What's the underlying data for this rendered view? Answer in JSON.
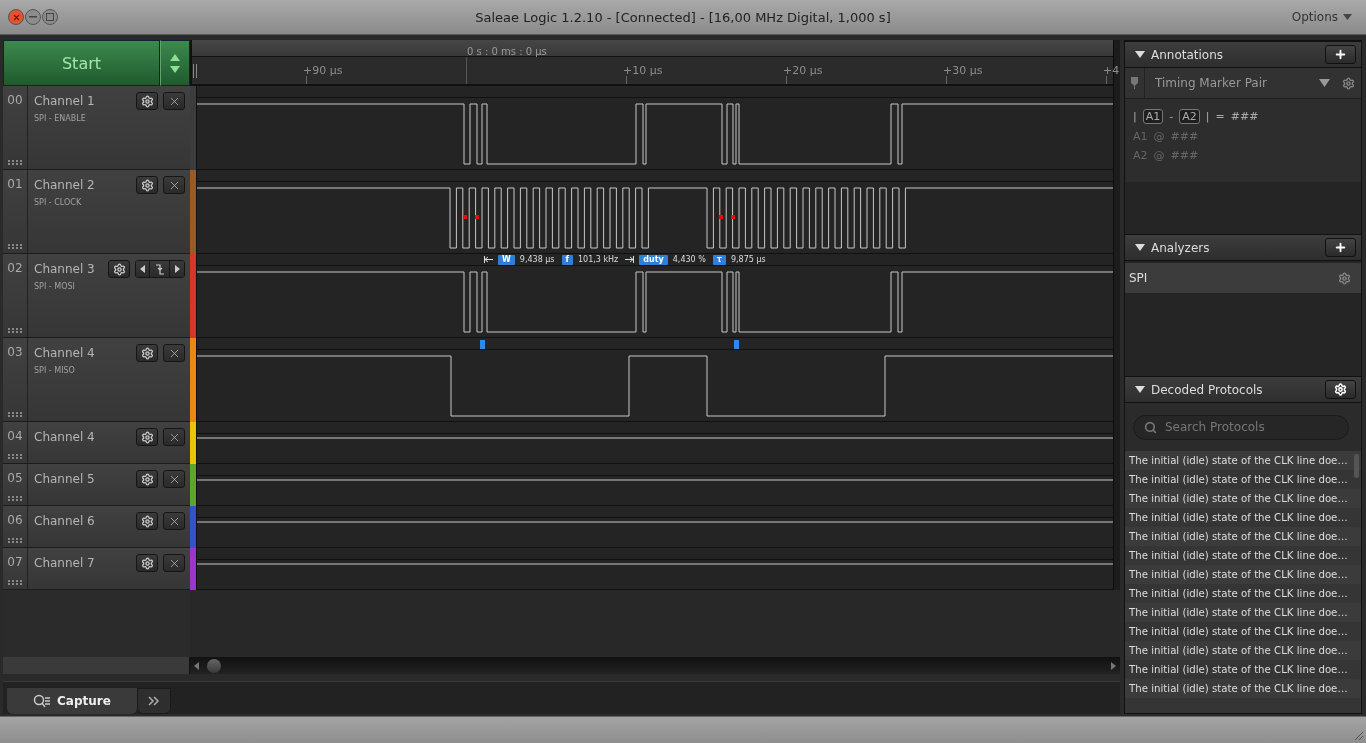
{
  "window": {
    "title": "Saleae Logic 1.2.10 - [Connected] - [16,00 MHz Digital, 1,000 s]",
    "menu": "Options"
  },
  "start_button": {
    "label": "Start"
  },
  "timeline": {
    "origin": "0 s : 0 ms : 0 µs",
    "ticks": [
      "+90 µs",
      "+10 µs",
      "+20 µs",
      "+30 µs",
      "+4"
    ]
  },
  "channels": [
    {
      "number": "00",
      "name": "Channel 1",
      "subtitle": "SPI - ENABLE",
      "color": "#3c3c3c",
      "kind": "enable",
      "trigger": false
    },
    {
      "number": "01",
      "name": "Channel 2",
      "subtitle": "SPI - CLOCK",
      "color": "#9a5a26",
      "kind": "clock",
      "trigger": false
    },
    {
      "number": "02",
      "name": "Channel 3",
      "subtitle": "SPI - MOSI",
      "color": "#d8342a",
      "kind": "enable",
      "trigger": true,
      "measurements": [
        {
          "badge": "W",
          "value": "9,438 µs"
        },
        {
          "badge": "f",
          "value": "101,3 kHz"
        },
        {
          "badge": "duty",
          "value": "4,430 %"
        },
        {
          "badge": "τ",
          "value": "9,875 µs"
        }
      ]
    },
    {
      "number": "03",
      "name": "Channel 4",
      "subtitle": "SPI - MISO",
      "color": "#e88a12",
      "kind": "miso",
      "trigger": false
    },
    {
      "number": "04",
      "name": "Channel 4",
      "color": "#e8c40a",
      "kind": "flat",
      "trigger": false
    },
    {
      "number": "05",
      "name": "Channel 5",
      "color": "#5ea52c",
      "kind": "flat",
      "trigger": false
    },
    {
      "number": "06",
      "name": "Channel 6",
      "color": "#3453c4",
      "kind": "flat",
      "trigger": false
    },
    {
      "number": "07",
      "name": "Channel 7",
      "color": "#9a36c8",
      "kind": "flat",
      "trigger": false
    }
  ],
  "tabs": [
    {
      "label": "Capture",
      "selected": true
    }
  ],
  "annotations": {
    "title": "Annotations",
    "marker_type": "Timing Marker Pair",
    "formula": {
      "open": "|",
      "a": "A1",
      "minus": "-",
      "b": "A2",
      "close": "|",
      "equals": "=",
      "value": "###"
    },
    "markers": [
      {
        "label": "A1",
        "at": "@",
        "value": "###"
      },
      {
        "label": "A2",
        "at": "@",
        "value": "###"
      }
    ]
  },
  "analyzers": {
    "title": "Analyzers",
    "items": [
      {
        "name": "SPI"
      }
    ]
  },
  "decoded_protocols": {
    "title": "Decoded Protocols",
    "search": {
      "placeholder": "Search Protocols"
    },
    "rows": [
      "The initial (idle) state of the CLK line doe…",
      "The initial (idle) state of the CLK line doe…",
      "The initial (idle) state of the CLK line doe…",
      "The initial (idle) state of the CLK line doe…",
      "The initial (idle) state of the CLK line doe…",
      "The initial (idle) state of the CLK line doe…",
      "The initial (idle) state of the CLK line doe…",
      "The initial (idle) state of the CLK line doe…",
      "The initial (idle) state of the CLK line doe…",
      "The initial (idle) state of the CLK line doe…",
      "The initial (idle) state of the CLK line doe…",
      "The initial (idle) state of the CLK line doe…",
      "The initial (idle) state of the CLK line doe…"
    ]
  }
}
